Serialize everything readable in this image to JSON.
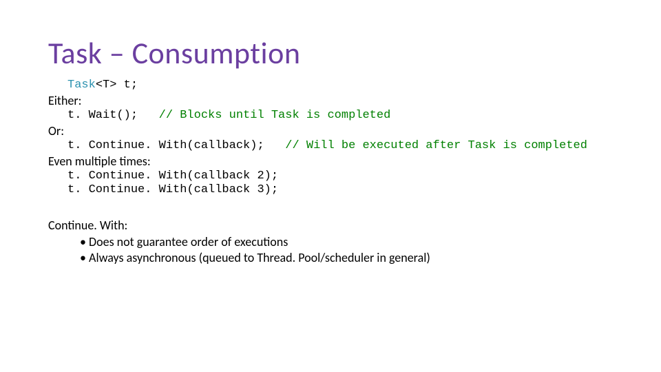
{
  "title": "Task – Consumption",
  "decl_type": "Task",
  "decl_generic": "<T>",
  "decl_rest": " t;",
  "label_either": "Either:",
  "wait_code": "t. Wait();   ",
  "wait_comment": "// Blocks until Task is completed",
  "label_or": "Or:",
  "cw1_code": "t. Continue. With(callback);   ",
  "cw1_comment": "// Will be executed after Task is completed",
  "label_mult": "Even multiple times:",
  "cw2_code": "t. Continue. With(callback 2);",
  "cw3_code": "t. Continue. With(callback 3);",
  "cw_heading": "Continue. With:",
  "bullet1": "Does not guarantee order of executions",
  "bullet2": "Always asynchronous (queued to Thread. Pool/scheduler in general)"
}
